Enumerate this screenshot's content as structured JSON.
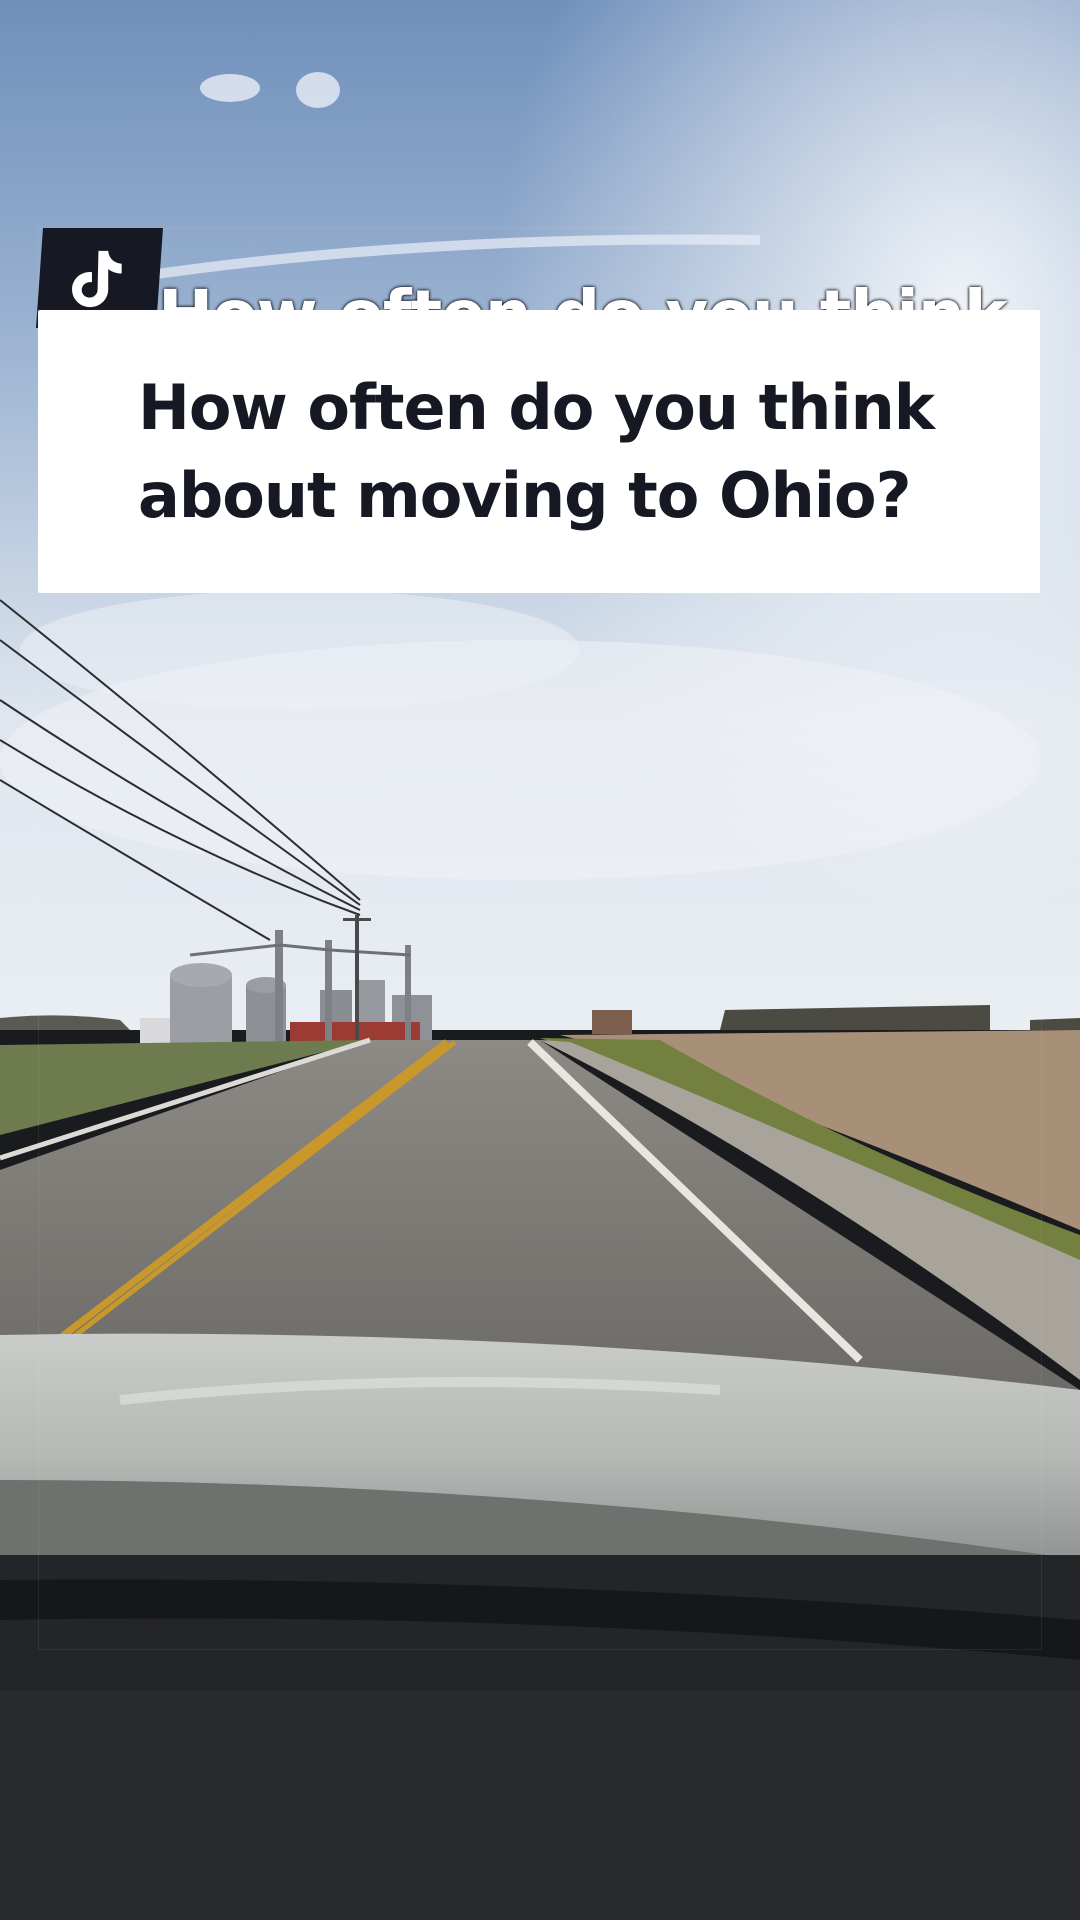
{
  "caption": {
    "lines": [
      "How often do you think",
      "about moving to Ohio?"
    ],
    "ghost": "How often do you think"
  },
  "icons": {
    "logo": "tiktok-icon"
  },
  "colors": {
    "card": "#ffffff",
    "text": "#161823",
    "logo_tile": "#161823"
  }
}
